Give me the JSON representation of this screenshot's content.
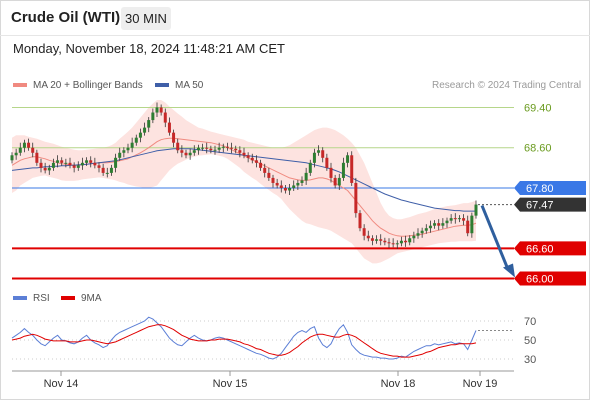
{
  "header": {
    "instrument": "Crude Oil (WTI)",
    "timeframe": "30 MIN",
    "timestamp": "Monday, November 18, 2024 11:48:21 AM CET"
  },
  "legend": {
    "bb_label": "MA 20 + Bollinger Bands",
    "ma50_label": "MA 50",
    "credit": "Research © 2024 Trading Central",
    "rsi_label": "RSI",
    "rsi_ma_label": "9MA"
  },
  "colors": {
    "up": "#2e7d32",
    "down": "#c62828",
    "bb_fill": "#fde3e0",
    "ma20": "#f08a80",
    "ma50": "#3f5fa8",
    "resistance": "#6a9b1f",
    "pivot": "#3a78e6",
    "support": "#e00000",
    "last": "#333333",
    "arrow": "#2f5f9e"
  },
  "chart_data": [
    {
      "type": "candlestick",
      "x_tick_labels": [
        "Nov 14",
        "Nov 15",
        "Nov 18",
        "Nov 19"
      ],
      "ylim": [
        65.6,
        69.8
      ],
      "levels": [
        {
          "value": 69.4,
          "label": "69.40",
          "kind": "resistance"
        },
        {
          "value": 68.6,
          "label": "68.60",
          "kind": "resistance"
        },
        {
          "value": 67.8,
          "label": "67.80",
          "kind": "pivot"
        },
        {
          "value": 67.47,
          "label": "67.47",
          "kind": "last"
        },
        {
          "value": 66.6,
          "label": "66.60",
          "kind": "support"
        },
        {
          "value": 66.0,
          "label": "66.00",
          "kind": "support"
        }
      ],
      "closes": [
        68.45,
        68.5,
        68.6,
        68.7,
        68.6,
        68.5,
        68.3,
        68.2,
        68.15,
        68.2,
        68.3,
        68.35,
        68.3,
        68.3,
        68.25,
        68.2,
        68.25,
        68.3,
        68.35,
        68.3,
        68.25,
        68.2,
        68.1,
        68.1,
        68.2,
        68.4,
        68.5,
        68.55,
        68.6,
        68.7,
        68.8,
        68.9,
        69.0,
        69.15,
        69.3,
        69.4,
        69.3,
        69.1,
        68.9,
        68.7,
        68.55,
        68.5,
        68.45,
        68.5,
        68.55,
        68.6,
        68.6,
        68.58,
        68.55,
        68.56,
        68.6,
        68.62,
        68.6,
        68.58,
        68.55,
        68.5,
        68.45,
        68.4,
        68.35,
        68.3,
        68.2,
        68.1,
        68.0,
        67.9,
        67.85,
        67.8,
        67.75,
        67.8,
        67.85,
        67.9,
        67.95,
        68.1,
        68.3,
        68.5,
        68.55,
        68.4,
        68.2,
        68.0,
        67.85,
        68.0,
        68.3,
        68.45,
        67.9,
        67.3,
        67.0,
        66.85,
        66.8,
        66.75,
        66.78,
        66.75,
        66.72,
        66.7,
        66.68,
        66.7,
        66.75,
        66.72,
        66.8,
        66.85,
        66.9,
        66.95,
        67.0,
        67.05,
        67.1,
        67.05,
        67.1,
        67.15,
        67.2,
        67.18,
        67.2,
        67.15,
        66.9,
        67.25,
        67.47
      ],
      "ma20": [
        68.25,
        68.3,
        68.35,
        68.38,
        68.4,
        68.42,
        68.42,
        68.4,
        68.38,
        68.35,
        68.33,
        68.3,
        68.28,
        68.27,
        68.26,
        68.25,
        68.25,
        68.26,
        68.27,
        68.28,
        68.29,
        68.3,
        68.3,
        68.3,
        68.31,
        68.32,
        68.34,
        68.36,
        68.38,
        68.42,
        68.46,
        68.5,
        68.55,
        68.6,
        68.66,
        68.72,
        68.76,
        68.78,
        68.79,
        68.79,
        68.78,
        68.77,
        68.76,
        68.75,
        68.74,
        68.73,
        68.72,
        68.71,
        68.7,
        68.68,
        68.66,
        68.64,
        68.6,
        68.56,
        68.52,
        68.48,
        68.44,
        68.4,
        68.36,
        68.32,
        68.28,
        68.24,
        68.2,
        68.16,
        68.12,
        68.08,
        68.04,
        68.0,
        67.98,
        67.96,
        67.95,
        67.95,
        67.96,
        67.98,
        68.0,
        68.0,
        67.98,
        67.95,
        67.9,
        67.85,
        67.8,
        67.75,
        67.65,
        67.55,
        67.45,
        67.35,
        67.25,
        67.15,
        67.07,
        67.0,
        66.95,
        66.9,
        66.87,
        66.85,
        66.84,
        66.84,
        66.85,
        66.86,
        66.87,
        66.88,
        66.9,
        66.92,
        66.94,
        66.96,
        66.98,
        67.0,
        67.02,
        67.04,
        67.05,
        67.06,
        67.06,
        67.07,
        67.1
      ],
      "ma50": [
        68.15,
        68.16,
        68.17,
        68.18,
        68.19,
        68.2,
        68.2,
        68.21,
        68.22,
        68.22,
        68.23,
        68.23,
        68.24,
        68.24,
        68.25,
        68.25,
        68.26,
        68.26,
        68.27,
        68.28,
        68.29,
        68.3,
        68.31,
        68.32,
        68.33,
        68.34,
        68.36,
        68.38,
        68.4,
        68.42,
        68.44,
        68.46,
        68.48,
        68.5,
        68.52,
        68.54,
        68.55,
        68.56,
        68.57,
        68.58,
        68.58,
        68.58,
        68.58,
        68.58,
        68.57,
        68.56,
        68.55,
        68.54,
        68.53,
        68.52,
        68.51,
        68.5,
        68.49,
        68.48,
        68.47,
        68.46,
        68.45,
        68.44,
        68.43,
        68.42,
        68.41,
        68.4,
        68.39,
        68.38,
        68.37,
        68.36,
        68.35,
        68.34,
        68.33,
        68.32,
        68.31,
        68.3,
        68.28,
        68.26,
        68.24,
        68.22,
        68.2,
        68.18,
        68.15,
        68.12,
        68.08,
        68.04,
        68.0,
        67.96,
        67.92,
        67.88,
        67.84,
        67.8,
        67.76,
        67.72,
        67.68,
        67.65,
        67.62,
        67.59,
        67.56,
        67.54,
        67.52,
        67.5,
        67.48,
        67.46,
        67.44,
        67.42,
        67.4,
        67.39,
        67.38,
        67.37,
        67.36,
        67.35,
        67.35,
        67.34,
        67.34,
        67.34,
        67.34
      ],
      "bb_upper": [
        68.8,
        68.85,
        68.85,
        68.85,
        68.82,
        68.8,
        68.78,
        68.75,
        68.72,
        68.7,
        68.68,
        68.65,
        68.62,
        68.6,
        68.58,
        68.56,
        68.55,
        68.55,
        68.56,
        68.57,
        68.58,
        68.59,
        68.6,
        68.62,
        68.65,
        68.7,
        68.78,
        68.85,
        68.92,
        69.0,
        69.1,
        69.2,
        69.3,
        69.4,
        69.48,
        69.55,
        69.55,
        69.5,
        69.42,
        69.35,
        69.28,
        69.22,
        69.15,
        69.1,
        69.05,
        69.0,
        68.98,
        68.95,
        68.92,
        68.9,
        68.88,
        68.86,
        68.84,
        68.82,
        68.8,
        68.78,
        68.76,
        68.72,
        68.7,
        68.68,
        68.66,
        68.64,
        68.62,
        68.6,
        68.6,
        68.6,
        68.62,
        68.65,
        68.7,
        68.75,
        68.8,
        68.85,
        68.9,
        68.95,
        68.98,
        69.0,
        69.0,
        68.98,
        68.95,
        68.9,
        68.85,
        68.78,
        68.7,
        68.6,
        68.45,
        68.3,
        68.1,
        67.9,
        67.7,
        67.5,
        67.35,
        67.25,
        67.2,
        67.18,
        67.18,
        67.2,
        67.22,
        67.25,
        67.28,
        67.3,
        67.32,
        67.35,
        67.38,
        67.4,
        67.42,
        67.44,
        67.45,
        67.46,
        67.48,
        67.5,
        67.5,
        67.52,
        67.55
      ],
      "bb_lower": [
        67.7,
        67.75,
        67.85,
        67.9,
        67.95,
        68.0,
        68.02,
        68.04,
        68.05,
        68.02,
        68.0,
        67.98,
        67.95,
        67.94,
        67.94,
        67.94,
        67.95,
        67.97,
        67.98,
        67.99,
        68.0,
        68.01,
        68.0,
        67.98,
        67.97,
        67.95,
        67.92,
        67.9,
        67.87,
        67.85,
        67.83,
        67.82,
        67.8,
        67.8,
        67.82,
        67.85,
        67.95,
        68.05,
        68.15,
        68.22,
        68.28,
        68.32,
        68.36,
        68.4,
        68.42,
        68.44,
        68.45,
        68.46,
        68.47,
        68.46,
        68.44,
        68.42,
        68.38,
        68.32,
        68.26,
        68.2,
        68.12,
        68.06,
        68.0,
        67.95,
        67.88,
        67.82,
        67.76,
        67.7,
        67.65,
        67.58,
        67.48,
        67.38,
        67.3,
        67.22,
        67.15,
        67.1,
        67.08,
        67.05,
        67.02,
        67.0,
        66.98,
        66.95,
        66.9,
        66.85,
        66.8,
        66.75,
        66.7,
        66.6,
        66.5,
        66.4,
        66.35,
        66.3,
        66.3,
        66.32,
        66.36,
        66.4,
        66.45,
        66.5,
        66.52,
        66.54,
        66.56,
        66.58,
        66.6,
        66.62,
        66.64,
        66.66,
        66.68,
        66.7,
        66.71,
        66.72,
        66.73,
        66.73,
        66.74,
        66.74,
        66.74,
        66.74,
        66.75
      ]
    },
    {
      "type": "line",
      "series": [
        {
          "name": "RSI"
        },
        {
          "name": "9MA"
        }
      ],
      "ylim": [
        20,
        80
      ],
      "y_tick_labels": [
        "70",
        "50",
        "30"
      ],
      "rsi": [
        52,
        55,
        58,
        62,
        58,
        55,
        50,
        46,
        44,
        48,
        52,
        55,
        50,
        49,
        47,
        46,
        48,
        52,
        55,
        50,
        47,
        45,
        42,
        44,
        50,
        55,
        58,
        60,
        62,
        64,
        66,
        68,
        70,
        74,
        72,
        68,
        64,
        58,
        52,
        48,
        45,
        44,
        48,
        52,
        55,
        52,
        50,
        49,
        50,
        52,
        53,
        52,
        50,
        48,
        46,
        44,
        42,
        40,
        38,
        36,
        35,
        33,
        31,
        30,
        32,
        36,
        42,
        48,
        54,
        58,
        60,
        58,
        62,
        64,
        52,
        45,
        42,
        46,
        55,
        62,
        66,
        58,
        45,
        40,
        36,
        34,
        33,
        32,
        32,
        31,
        31,
        30,
        30,
        31,
        33,
        32,
        35,
        38,
        40,
        42,
        44,
        44,
        46,
        45,
        46,
        47,
        48,
        46,
        47,
        46,
        40,
        50,
        60
      ],
      "rsi_ma": [
        50,
        51,
        52,
        54,
        55,
        56,
        55,
        53,
        51,
        50,
        49,
        49,
        49,
        49,
        48,
        48,
        48,
        49,
        50,
        50,
        49,
        48,
        47,
        46,
        47,
        48,
        50,
        52,
        54,
        56,
        58,
        60,
        62,
        64,
        65,
        66,
        66,
        65,
        63,
        61,
        58,
        55,
        53,
        51,
        50,
        49,
        49,
        49,
        50,
        50,
        51,
        51,
        51,
        50,
        49,
        48,
        46,
        45,
        43,
        41,
        40,
        38,
        36,
        35,
        34,
        34,
        35,
        37,
        40,
        43,
        47,
        50,
        53,
        55,
        56,
        56,
        55,
        54,
        53,
        53,
        55,
        56,
        55,
        53,
        50,
        47,
        44,
        41,
        38,
        36,
        35,
        34,
        33,
        33,
        32,
        32,
        32,
        33,
        34,
        35,
        37,
        38,
        40,
        42,
        43,
        44,
        45,
        45,
        46,
        46,
        46,
        46,
        47
      ]
    }
  ]
}
